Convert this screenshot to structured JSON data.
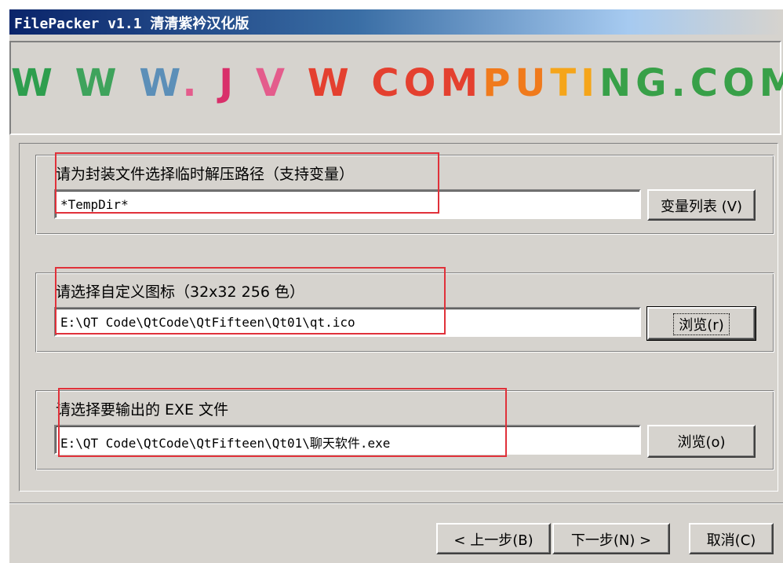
{
  "window": {
    "title": "FilePacker v1.1 清清紫衿汉化版"
  },
  "banner": {
    "letters": [
      "W",
      " W",
      " W",
      ".",
      " J",
      " V",
      " W",
      " COM",
      "PU",
      "TI",
      "NG.COM"
    ]
  },
  "groups": [
    {
      "label": "请为封装文件选择临时解压路径（支持变量）",
      "value": "*TempDir*",
      "button": "变量列表 (V)"
    },
    {
      "label": "请选择自定义图标（32x32 256 色）",
      "value": "E:\\QT Code\\QtCode\\QtFifteen\\Qt01\\qt.ico",
      "button": "浏览(r)"
    },
    {
      "label": "请选择要输出的 EXE 文件",
      "value": "E:\\QT Code\\QtCode\\QtFifteen\\Qt01\\聊天软件.exe",
      "button": "浏览(o)"
    }
  ],
  "footer": {
    "back": "< 上一步(B)",
    "next": "下一步(N) >",
    "cancel": "取消(C)"
  },
  "colors": {
    "annotation": "#e0313a",
    "titlebar": "#0a246a",
    "face": "#d6d3ce"
  }
}
